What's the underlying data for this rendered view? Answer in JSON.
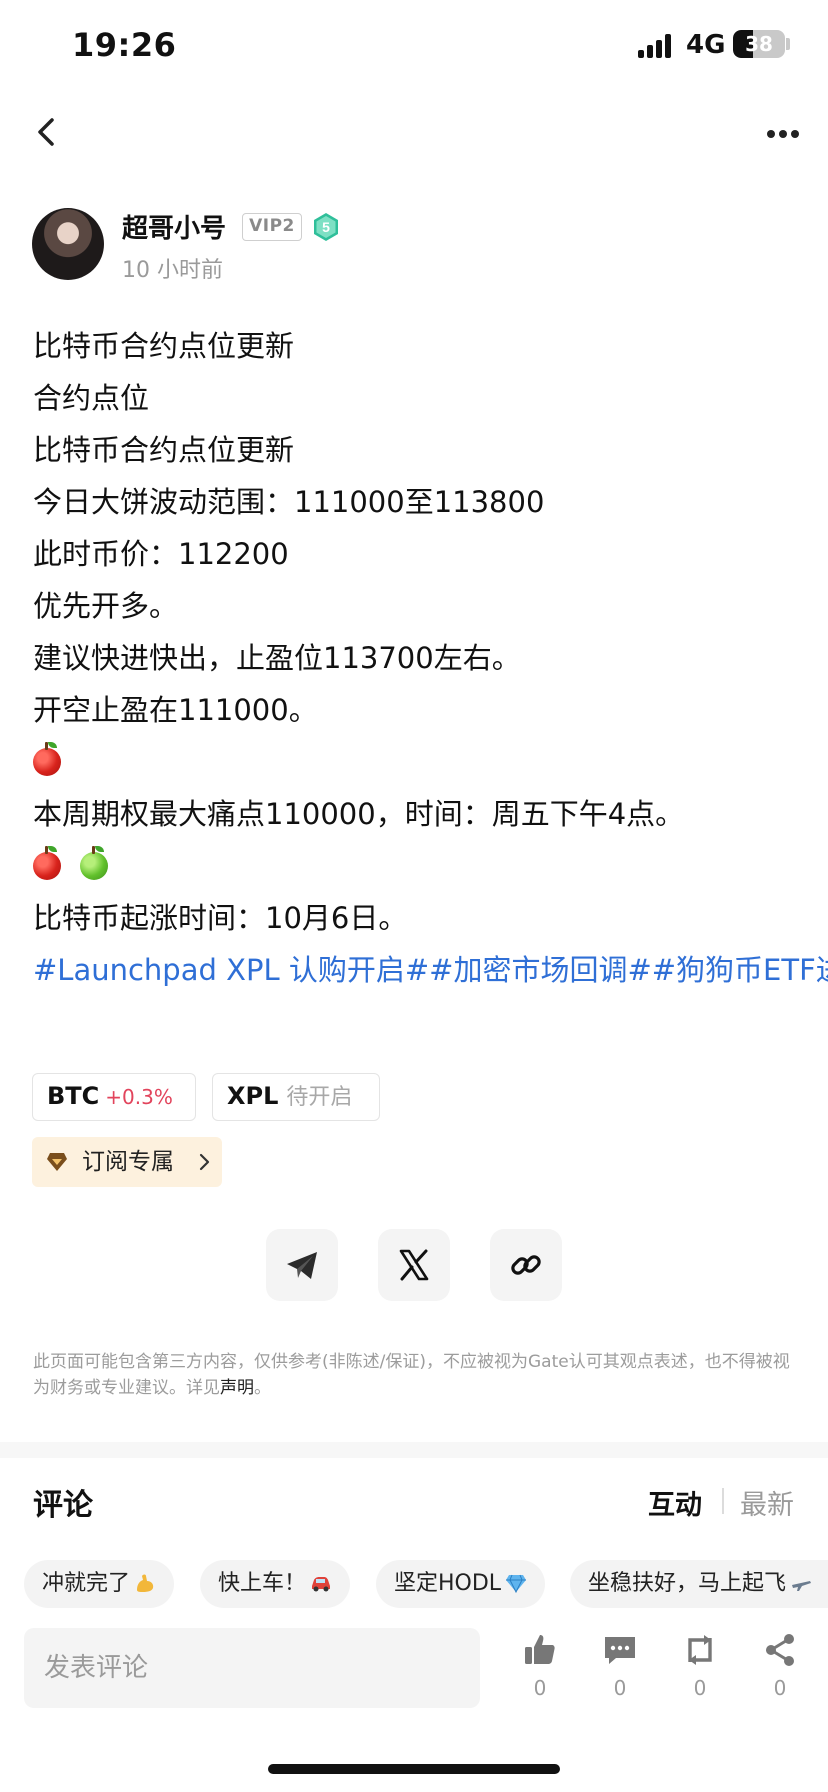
{
  "status_bar": {
    "time": "19:26",
    "network": "4G",
    "battery": "38",
    "battery_level": 0.38
  },
  "author": {
    "name": "超哥小号",
    "vip": "VIP2",
    "level": "5",
    "time": "10 小时前"
  },
  "content": {
    "lines": [
      "比特币合约点位更新",
      "合约点位",
      "比特币合约点位更新",
      "今日大饼波动范围：111000至113800",
      "此时币价：112200",
      "优先开多。",
      "建议快进快出，止盈位113700左右。",
      "开空止盈在111000。",
      "本周期权最大痛点110000，时间：周五下午4点。",
      "比特币起涨时间：10月6日。"
    ],
    "emoji_apple_red": "red-apple",
    "emoji_apple_green": "green-apple",
    "hashtags": "#Launchpad XPL 认购开启##加密市场回调##狗狗币ETF进展#"
  },
  "tickers": [
    {
      "symbol": "BTC",
      "change": "+0.3%"
    },
    {
      "symbol": "XPL",
      "status": "待开启"
    }
  ],
  "subscribe": {
    "label": "订阅专属"
  },
  "share": {
    "icons": [
      "telegram-icon",
      "x-icon",
      "link-icon"
    ]
  },
  "disclaimer": {
    "text": "此页面可能包含第三方内容，仅供参考(非陈述/保证)，不应被视为Gate认可其观点表述，也不得被视为财务或专业建议。详见",
    "link": "声明",
    "end": "。"
  },
  "comments": {
    "title": "评论",
    "tabs": {
      "interact": "互动",
      "latest": "最新"
    },
    "quick_replies": [
      "冲就完了",
      "快上车！",
      "坚定HODL",
      "坐稳扶好，马上起飞"
    ],
    "input_placeholder": "发表评论",
    "actions": [
      {
        "name": "like",
        "count": "0"
      },
      {
        "name": "comment",
        "count": "0"
      },
      {
        "name": "repost",
        "count": "0"
      },
      {
        "name": "share",
        "count": "0"
      }
    ]
  },
  "colors": {
    "link": "#2f6fd6",
    "price_up": "#e2445c",
    "badge_green": "#2fbf9a",
    "subscribe_bg": "#fdf1de"
  }
}
